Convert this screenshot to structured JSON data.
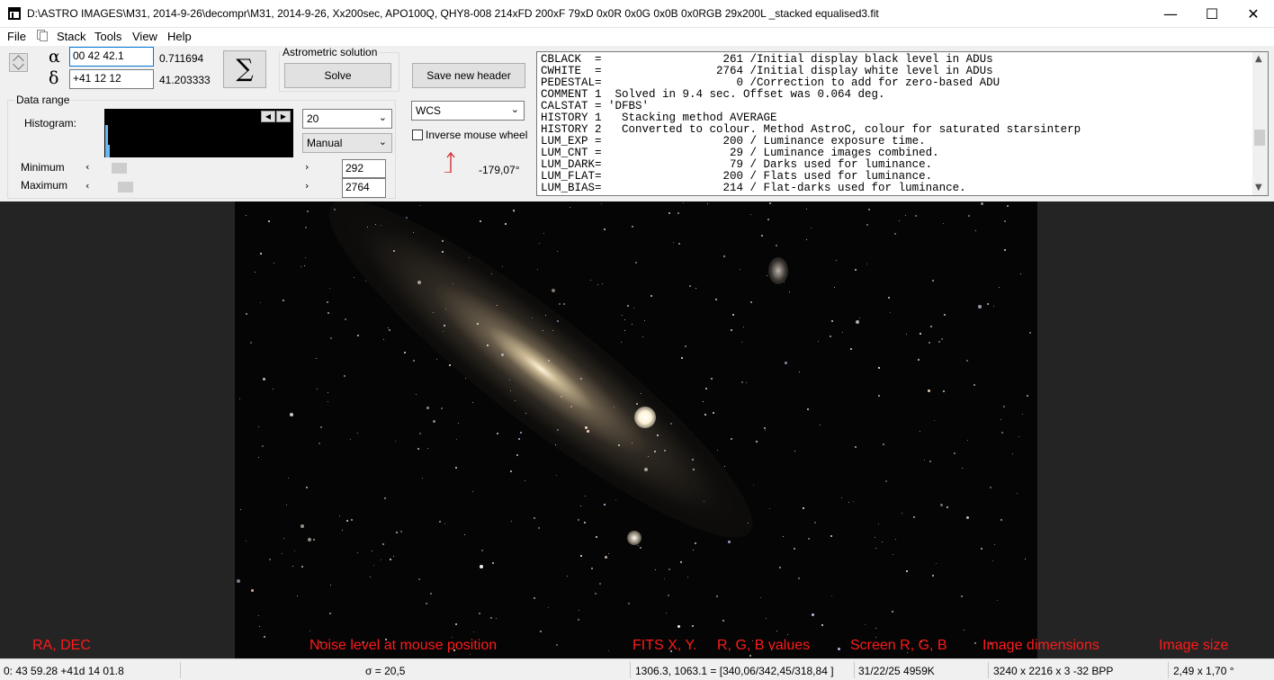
{
  "window": {
    "title": "D:\\ASTRO IMAGES\\M31, 2014-9-26\\decompr\\M31, 2014-9-26, Xx200sec, APO100Q, QHY8-008  214xFD  200xF  79xD  0x0R  0x0G  0x0B  0x0RGB  29x200L  _stacked equalised3.fit",
    "minimize": "—",
    "maximize": "☐",
    "close": "✕"
  },
  "menu": {
    "file": "File",
    "stack": "Stack",
    "tools": "Tools",
    "view": "View",
    "help": "Help"
  },
  "position": {
    "alpha_symbol": "α",
    "delta_symbol": "δ",
    "ra_input": "00 42 42.1",
    "dec_input": "+41 12 12",
    "ra_decimal": "0.711694",
    "dec_decimal": "41.203333"
  },
  "sigma_label": "∑",
  "astrometric": {
    "group_label": "Astrometric solution",
    "solve_label": "Solve",
    "save_header_label": "Save new header"
  },
  "data_range": {
    "group_label": "Data range",
    "histogram_label": "Histogram:",
    "minimum_label": "Minimum",
    "maximum_label": "Maximum",
    "minimum_value": "292",
    "maximum_value": "2764",
    "minimum_level": 0.08,
    "maximum_level": 0.11,
    "range_combo": "20",
    "mode_combo": "Manual"
  },
  "wcs": {
    "combo": "WCS",
    "inverse_label": "Inverse mouse wheel",
    "angle": "-179,07°"
  },
  "fits_header": [
    "CBLACK  =                  261 /Initial display black level in ADUs",
    "CWHITE  =                 2764 /Initial display white level in ADUs",
    "PEDESTAL=                    0 /Correction to add for zero-based ADU",
    "COMMENT 1  Solved in 9.4 sec. Offset was 0.064 deg.",
    "CALSTAT = 'DFBS'",
    "HISTORY 1   Stacking method AVERAGE",
    "HISTORY 2   Converted to colour. Method AstroC, colour for saturated starsinterp",
    "LUM_EXP =                  200 / Luminance exposure time.",
    "LUM_CNT =                   29 / Luminance images combined.",
    "LUM_DARK=                   79 / Darks used for luminance.",
    "LUM_FLAT=                  200 / Flats used for luminance.",
    "LUM_BIAS=                  214 / Flat-darks used for luminance."
  ],
  "annotations": {
    "ra_dec": "RA, DEC",
    "noise": "Noise level at mouse position",
    "fits_xy": "FITS X, Y.",
    "rgb_values": "R, G, B values",
    "screen_rgb": "Screen R, G, B",
    "image_dimensions": "Image dimensions",
    "image_size": "Image size"
  },
  "status": {
    "ra_dec": "0: 43  59.28  +41d 14  01.8",
    "noise": "σ = 20,5",
    "pixel": "1306.3, 1063.1 = [340,06/342,45/318,84 ]",
    "screen": "31/22/25  4959K",
    "dimensions": "3240 x 2216 x 3   -32 BPP",
    "size": "2,49 x 1,70 °"
  },
  "colors": {
    "annotation": "#ff1a1a",
    "focus_border": "#0078d7",
    "histogram_spike": "#6ab8f0"
  }
}
